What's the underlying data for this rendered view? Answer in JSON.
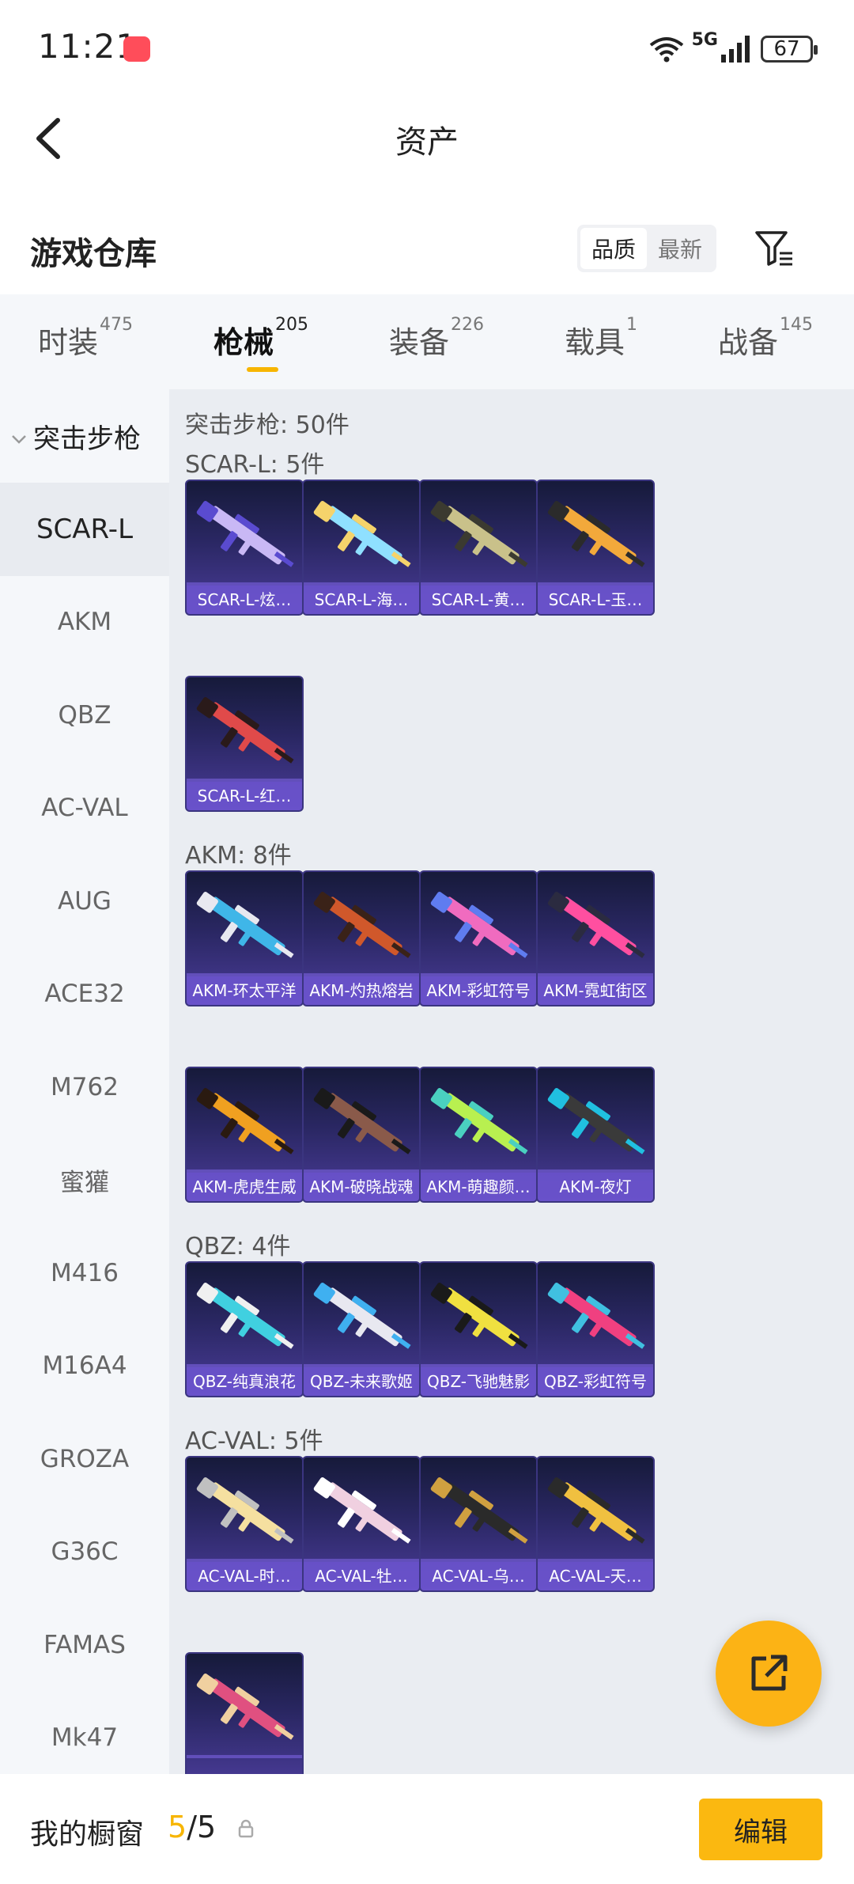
{
  "status_bar": {
    "time": "11:21",
    "network": "5G",
    "battery": "67"
  },
  "header": {
    "title": "资产"
  },
  "section": {
    "title": "游戏仓库",
    "sort_options": [
      "品质",
      "最新"
    ],
    "active_sort": "品质"
  },
  "tabs": [
    {
      "label": "时装",
      "count": "475"
    },
    {
      "label": "枪械",
      "count": "205"
    },
    {
      "label": "装备",
      "count": "226"
    },
    {
      "label": "载具",
      "count": "1"
    },
    {
      "label": "战备",
      "count": "145"
    }
  ],
  "active_tab": "枪械",
  "sidebar": {
    "group": "突击步枪",
    "items": [
      "SCAR-L",
      "AKM",
      "QBZ",
      "AC-VAL",
      "AUG",
      "ACE32",
      "M762",
      "蜜獾",
      "M416",
      "M16A4",
      "GROZA",
      "G36C",
      "FAMAS",
      "Mk47"
    ],
    "active": "SCAR-L"
  },
  "content": {
    "summary": "突击步枪: 50件",
    "groups": [
      {
        "label": "SCAR-L: 5件",
        "items": [
          "SCAR-L-炫…",
          "SCAR-L-海…",
          "SCAR-L-黄…",
          "SCAR-L-玉…",
          "SCAR-L-红…"
        ]
      },
      {
        "label": "AKM: 8件",
        "items": [
          "AKM-环太平洋",
          "AKM-灼热熔岩",
          "AKM-彩虹符号",
          "AKM-霓虹街区",
          "AKM-虎虎生威",
          "AKM-破晓战魂",
          "AKM-萌趣颜…",
          "AKM-夜灯"
        ]
      },
      {
        "label": "QBZ: 4件",
        "items": [
          "QBZ-纯真浪花",
          "QBZ-未来歌姬",
          "QBZ-飞驰魅影",
          "QBZ-彩虹符号"
        ]
      },
      {
        "label": "AC-VAL: 5件",
        "items": [
          "AC-VAL-时…",
          "AC-VAL-牡…",
          "AC-VAL-乌…",
          "AC-VAL-天…",
          ""
        ]
      }
    ]
  },
  "bottom_bar": {
    "label": "我的橱窗",
    "current": "5",
    "total": "/5",
    "edit_label": "编辑"
  },
  "colors": {
    "accent": "#f7b500",
    "card_bg": "#2a2763",
    "card_label": "#6e56d2"
  }
}
